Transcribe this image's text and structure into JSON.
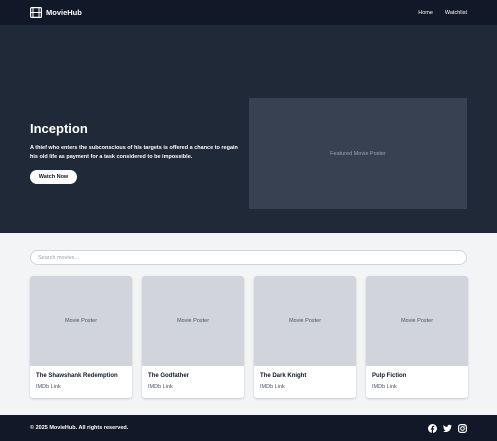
{
  "brand": {
    "name": "MovieHub",
    "icon": "film-icon"
  },
  "nav": {
    "links": [
      {
        "label": "Home"
      },
      {
        "label": "Watchlist"
      }
    ]
  },
  "hero": {
    "title": "Inception",
    "description": "A thief who enters the subconscious of his targets is offered a chance to regain his old life as payment for a task considered to be impossible.",
    "button_label": "Watch Now",
    "featured_label": "Featured Movie Poster"
  },
  "search": {
    "placeholder": "Search movies...",
    "value": ""
  },
  "movies": [
    {
      "poster_label": "Movie Poster",
      "title": "The Shawshank Redemption",
      "link": "IMDb Link"
    },
    {
      "poster_label": "Movie Poster",
      "title": "The Godfather",
      "link": "IMDb Link"
    },
    {
      "poster_label": "Movie Poster",
      "title": "The Dark Knight",
      "link": "IMDb Link"
    },
    {
      "poster_label": "Movie Poster",
      "title": "Pulp Fiction",
      "link": "IMDb Link"
    }
  ],
  "footer": {
    "copyright": "© 2025 MovieHub. All rights reserved.",
    "social_icons": [
      "facebook-icon",
      "twitter-icon",
      "instagram-icon"
    ]
  },
  "colors": {
    "navbar_bg": "#111827",
    "hero_bg": "#1f2937",
    "featured_bg": "#374151",
    "page_bg": "#f3f4f6",
    "poster_bg": "#d1d5db"
  }
}
